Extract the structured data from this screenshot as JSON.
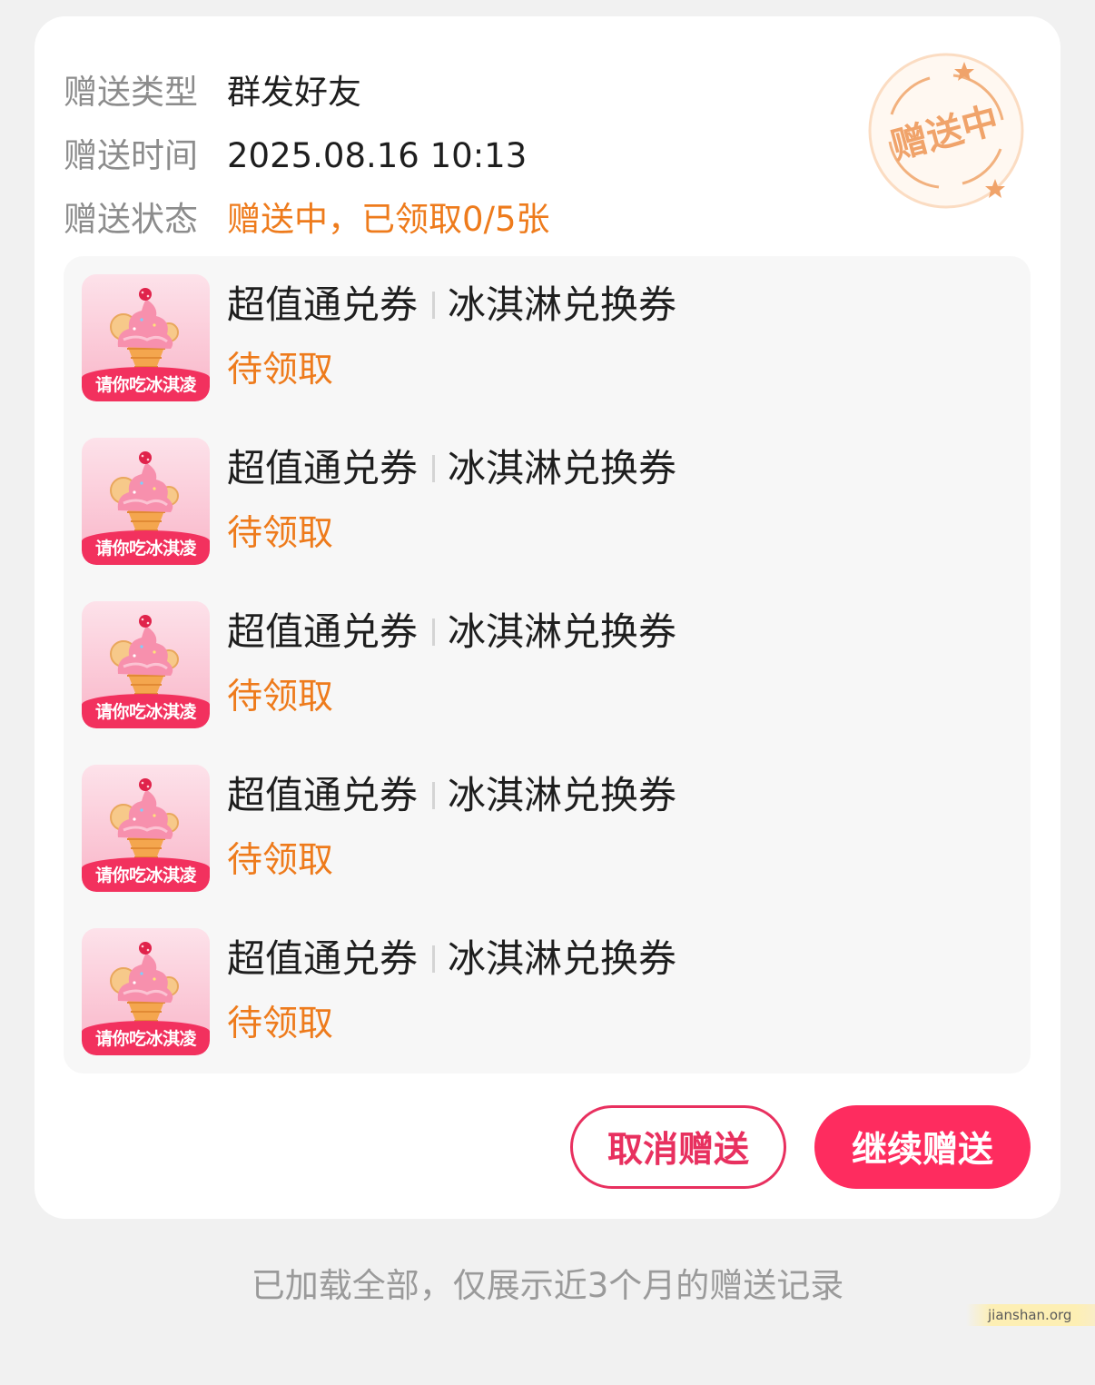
{
  "gift_info": {
    "type_label": "赠送类型",
    "type_value": "群发好友",
    "time_label": "赠送时间",
    "time_value": "2025.08.16 10:13",
    "status_label": "赠送状态",
    "status_value": "赠送中，已领取0/5张"
  },
  "stamp": {
    "text": "赠送中",
    "color": "#f0a36a"
  },
  "coupons": [
    {
      "banner": "请你吃冰淇凌",
      "name": "超值通兑券",
      "subname": "冰淇淋兑换券",
      "status": "待领取"
    },
    {
      "banner": "请你吃冰淇凌",
      "name": "超值通兑券",
      "subname": "冰淇淋兑换券",
      "status": "待领取"
    },
    {
      "banner": "请你吃冰淇凌",
      "name": "超值通兑券",
      "subname": "冰淇淋兑换券",
      "status": "待领取"
    },
    {
      "banner": "请你吃冰淇凌",
      "name": "超值通兑券",
      "subname": "冰淇淋兑换券",
      "status": "待领取"
    },
    {
      "banner": "请你吃冰淇凌",
      "name": "超值通兑券",
      "subname": "冰淇淋兑换券",
      "status": "待领取"
    }
  ],
  "actions": {
    "cancel_label": "取消赠送",
    "continue_label": "继续赠送"
  },
  "footer_text": "已加载全部，仅展示近3个月的赠送记录",
  "watermark_text": "jianshan.org",
  "colors": {
    "accent_pink": "#fe2c5f",
    "status_orange": "#ee7b1c",
    "page_background": "#f1f1f1"
  }
}
